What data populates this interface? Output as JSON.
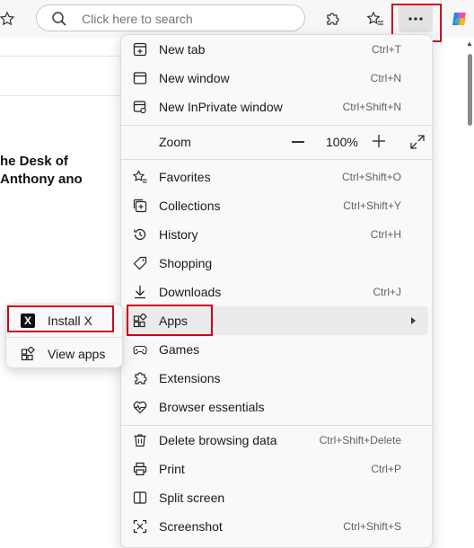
{
  "toolbar": {
    "search_placeholder": "Click here to search",
    "more_label": "···"
  },
  "page": {
    "title": "he Desk of Anthony ano"
  },
  "menu": {
    "items": [
      {
        "label": "New tab",
        "shortcut": "Ctrl+T",
        "icon": "new-tab-icon"
      },
      {
        "label": "New window",
        "shortcut": "Ctrl+N",
        "icon": "window-icon"
      },
      {
        "label": "New InPrivate window",
        "shortcut": "Ctrl+Shift+N",
        "icon": "inprivate-icon"
      },
      {
        "label": "Favorites",
        "shortcut": "Ctrl+Shift+O",
        "icon": "favorites-icon"
      },
      {
        "label": "Collections",
        "shortcut": "Ctrl+Shift+Y",
        "icon": "collections-icon"
      },
      {
        "label": "History",
        "shortcut": "Ctrl+H",
        "icon": "history-icon"
      },
      {
        "label": "Shopping",
        "shortcut": "",
        "icon": "tag-icon"
      },
      {
        "label": "Downloads",
        "shortcut": "Ctrl+J",
        "icon": "download-icon"
      },
      {
        "label": "Apps",
        "shortcut": "",
        "icon": "apps-icon"
      },
      {
        "label": "Games",
        "shortcut": "",
        "icon": "games-icon"
      },
      {
        "label": "Extensions",
        "shortcut": "",
        "icon": "puzzle-icon"
      },
      {
        "label": "Browser essentials",
        "shortcut": "",
        "icon": "heart-pulse-icon"
      },
      {
        "label": "Delete browsing data",
        "shortcut": "Ctrl+Shift+Delete",
        "icon": "trash-icon"
      },
      {
        "label": "Print",
        "shortcut": "Ctrl+P",
        "icon": "print-icon"
      },
      {
        "label": "Split screen",
        "shortcut": "",
        "icon": "split-screen-icon"
      },
      {
        "label": "Screenshot",
        "shortcut": "Ctrl+Shift+S",
        "icon": "screenshot-icon"
      }
    ],
    "zoom": {
      "label": "Zoom",
      "value": "100%"
    }
  },
  "submenu": {
    "items": [
      {
        "label": "Install X",
        "icon": "x-logo-icon"
      },
      {
        "label": "View apps",
        "icon": "apps-icon"
      }
    ]
  },
  "colors": {
    "highlight_border": "#d0021b",
    "menu_bg": "#f9f9f9",
    "hover_bg": "#ebebeb"
  }
}
